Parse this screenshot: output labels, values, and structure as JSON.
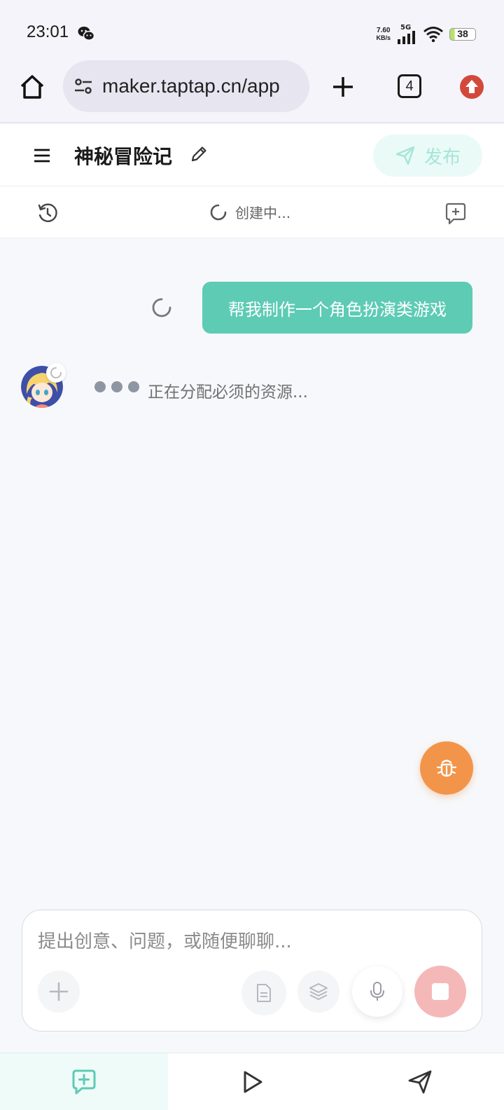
{
  "status_bar": {
    "time": "23:01",
    "net_speed_value": "7.60",
    "net_speed_unit": "KB/s",
    "network": "5G",
    "battery": "38"
  },
  "browser": {
    "url": "maker.taptap.cn/app",
    "tab_count": "4"
  },
  "header": {
    "title": "神秘冒险记",
    "publish_label": "发布"
  },
  "sub_header": {
    "status": "创建中..."
  },
  "chat": {
    "user_message": "帮我制作一个角色扮演类游戏",
    "assistant_status": "正在分配必须的资源..."
  },
  "input": {
    "placeholder": "提出创意、问题，或随便聊聊..."
  },
  "colors": {
    "accent": "#5ecbb5",
    "bug_button": "#f2954a",
    "stop_button": "#f5b8b8"
  }
}
